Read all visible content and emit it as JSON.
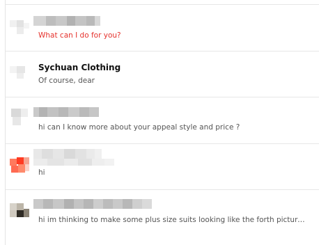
{
  "conversations": [
    {
      "name": "",
      "name_redacted": true,
      "preview": "What can I do for you?",
      "unread": true,
      "avatar_color": "#eeeeee"
    },
    {
      "name": "Sychuan Clothing",
      "name_redacted": false,
      "preview": "Of course, dear",
      "unread": false,
      "avatar_color": "#e9e9e9"
    },
    {
      "name": "",
      "name_redacted": true,
      "preview": "hi can I know more about your appeal style and price ?",
      "unread": false,
      "avatar_color": "#d8d8d8"
    },
    {
      "name": "",
      "name_redacted": true,
      "preview": "hi",
      "unread": false,
      "avatar_color": "#f2553c"
    },
    {
      "name": "",
      "name_redacted": true,
      "preview": "hi im thinking to make some plus size suits looking like the forth picture,...",
      "unread": false,
      "avatar_color": "#3a3630"
    }
  ],
  "colors": {
    "unread_text": "#e5322d",
    "divider": "#e6e6e6"
  }
}
